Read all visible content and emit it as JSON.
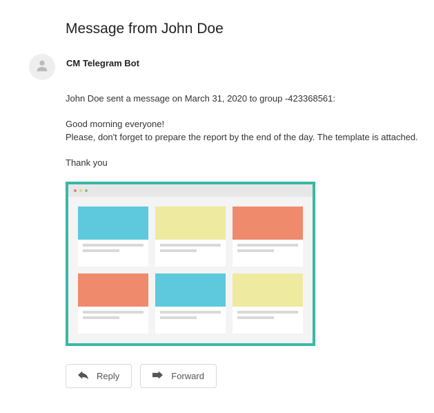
{
  "subject": "Message from John Doe",
  "sender": "CM Telegram Bot",
  "body": {
    "intro": "John Doe sent a message on March 31, 2020 to group -423368561:",
    "line1": "Good morning everyone!",
    "line2": "Please, don't forget to prepare the report by the end of the day. The template is attached.",
    "outro": "Thank you"
  },
  "actions": {
    "reply_label": "Reply",
    "forward_label": "Forward"
  }
}
